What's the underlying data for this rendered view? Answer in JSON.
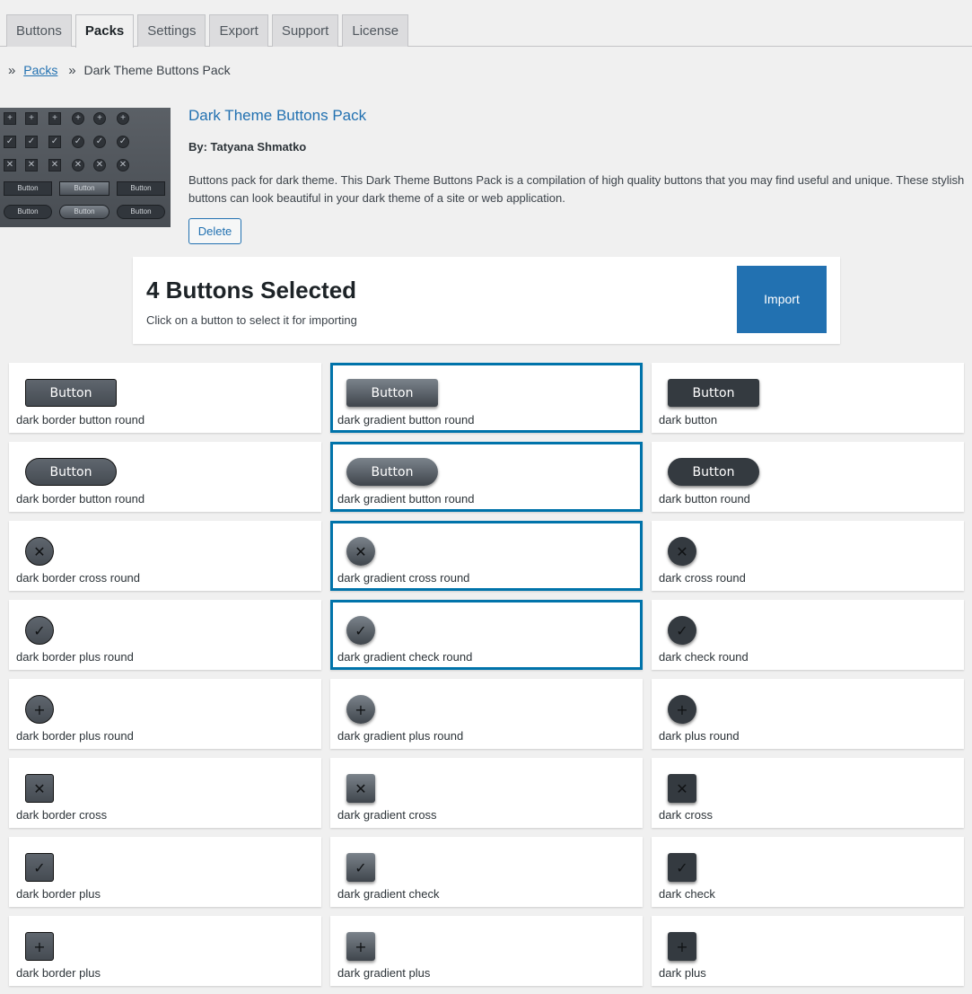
{
  "tabs": [
    "Buttons",
    "Packs",
    "Settings",
    "Export",
    "Support",
    "License"
  ],
  "active_tab": "Packs",
  "breadcrumb": {
    "link": "Packs",
    "current": "Dark Theme Buttons Pack",
    "separator": "»"
  },
  "pack": {
    "title": "Dark Theme Buttons Pack",
    "author": "By: Tatyana Shmatko",
    "description": "Buttons pack for dark theme. This Dark Theme Buttons Pack is a compilation of high quality buttons that you may find useful and unique. These stylish buttons can look beautiful in your dark theme of a site or web application.",
    "delete_label": "Delete",
    "thumbnail_button_label": "Button"
  },
  "selection": {
    "title": "4 Buttons Selected",
    "subtitle": "Click on a button to select it for importing",
    "import_label": "Import"
  },
  "buttons": [
    {
      "label": "dark border button round",
      "preview": "Button",
      "style": "border",
      "shape": "square",
      "kind": "text",
      "selected": false
    },
    {
      "label": "dark gradient button round",
      "preview": "Button",
      "style": "gradient",
      "shape": "square",
      "kind": "text",
      "selected": true
    },
    {
      "label": "dark button",
      "preview": "Button",
      "style": "dark",
      "shape": "square",
      "kind": "text",
      "selected": false
    },
    {
      "label": "dark border button round",
      "preview": "Button",
      "style": "border",
      "shape": "round",
      "kind": "text",
      "selected": false
    },
    {
      "label": "dark gradient button round",
      "preview": "Button",
      "style": "gradient",
      "shape": "round",
      "kind": "text",
      "selected": true
    },
    {
      "label": "dark button round",
      "preview": "Button",
      "style": "dark",
      "shape": "round",
      "kind": "text",
      "selected": false
    },
    {
      "label": "dark border cross round",
      "icon": "cross-icon",
      "style": "border",
      "shape": "circle",
      "kind": "icon",
      "selected": false
    },
    {
      "label": "dark gradient cross round",
      "icon": "cross-icon",
      "style": "gradient",
      "shape": "circle",
      "kind": "icon",
      "selected": true
    },
    {
      "label": "dark cross round",
      "icon": "cross-icon",
      "style": "dark",
      "shape": "circle",
      "kind": "icon",
      "selected": false
    },
    {
      "label": "dark border plus round",
      "icon": "check-icon",
      "style": "border",
      "shape": "circle",
      "kind": "icon",
      "selected": false
    },
    {
      "label": "dark gradient check round",
      "icon": "check-icon",
      "style": "gradient",
      "shape": "circle",
      "kind": "icon",
      "selected": true
    },
    {
      "label": "dark check round",
      "icon": "check-icon",
      "style": "dark",
      "shape": "circle",
      "kind": "icon",
      "selected": false
    },
    {
      "label": "dark border plus round",
      "icon": "plus-icon",
      "style": "border",
      "shape": "circle",
      "kind": "icon",
      "selected": false
    },
    {
      "label": "dark gradient plus round",
      "icon": "plus-icon",
      "style": "gradient",
      "shape": "circle",
      "kind": "icon",
      "selected": false
    },
    {
      "label": "dark plus round",
      "icon": "plus-icon",
      "style": "dark",
      "shape": "circle",
      "kind": "icon",
      "selected": false
    },
    {
      "label": "dark border cross",
      "icon": "cross-icon",
      "style": "border",
      "shape": "square",
      "kind": "icon",
      "selected": false
    },
    {
      "label": "dark gradient cross",
      "icon": "cross-icon",
      "style": "gradient",
      "shape": "square",
      "kind": "icon",
      "selected": false
    },
    {
      "label": "dark cross",
      "icon": "cross-icon",
      "style": "dark",
      "shape": "square",
      "kind": "icon",
      "selected": false
    },
    {
      "label": "dark border plus",
      "icon": "check-icon",
      "style": "border",
      "shape": "square",
      "kind": "icon",
      "selected": false
    },
    {
      "label": "dark gradient check",
      "icon": "check-icon",
      "style": "gradient",
      "shape": "square",
      "kind": "icon",
      "selected": false
    },
    {
      "label": "dark check",
      "icon": "check-icon",
      "style": "dark",
      "shape": "square",
      "kind": "icon",
      "selected": false
    },
    {
      "label": "dark border plus",
      "icon": "plus-icon",
      "style": "border",
      "shape": "square",
      "kind": "icon",
      "selected": false
    },
    {
      "label": "dark gradient plus",
      "icon": "plus-icon",
      "style": "gradient",
      "shape": "square",
      "kind": "icon",
      "selected": false
    },
    {
      "label": "dark plus",
      "icon": "plus-icon",
      "style": "dark",
      "shape": "square",
      "kind": "icon",
      "selected": false
    }
  ],
  "colors": {
    "accent": "#2271b1",
    "selected_border": "#0073aa",
    "background": "#f0f0f0"
  }
}
